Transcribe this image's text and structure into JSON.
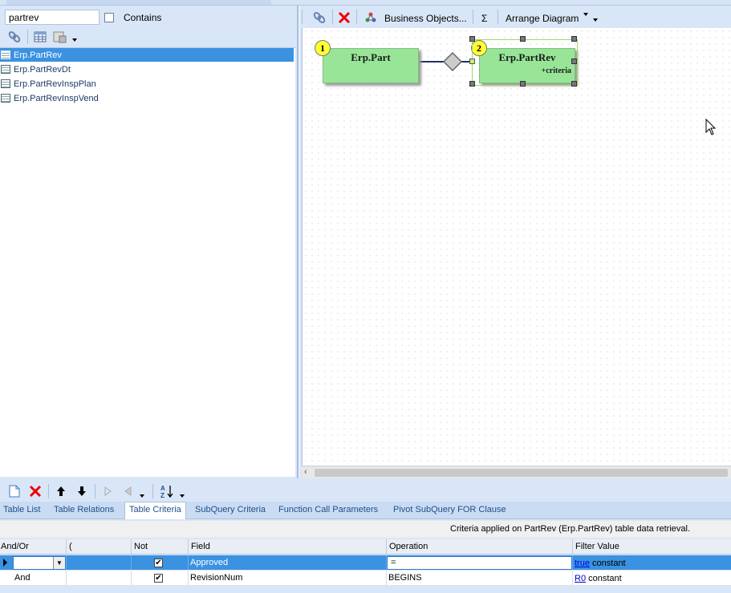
{
  "left": {
    "search_value": "partrev",
    "contains_label": "Contains",
    "tables": [
      "Erp.PartRev",
      "Erp.PartRevDt",
      "Erp.PartRevInspPlan",
      "Erp.PartRevInspVend"
    ],
    "selected_index": 0
  },
  "right_toolbar": {
    "business_objects_label": "Business Objects...",
    "sigma_label": "Σ",
    "arrange_label": "Arrange Diagram"
  },
  "diagram": {
    "entities": [
      {
        "badge": "1",
        "name": "Erp.Part",
        "subtitle": ""
      },
      {
        "badge": "2",
        "name": "Erp.PartRev",
        "subtitle": "+criteria"
      }
    ]
  },
  "tabs": [
    "Table List",
    "Table Relations",
    "Table Criteria",
    "SubQuery Criteria",
    "Function Call Parameters",
    "Pivot SubQuery FOR Clause"
  ],
  "active_tab": "Table Criteria",
  "info_text": "Criteria applied on PartRev (Erp.PartRev)  table data retrieval.",
  "grid": {
    "columns": [
      "And/Or",
      "(",
      "Not",
      "Field",
      "Operation",
      "Filter Value"
    ],
    "rows": [
      {
        "and_or": "",
        "paren": "",
        "not": true,
        "field": "Approved",
        "operation": "=",
        "value_link": "true",
        "value_type": "constant"
      },
      {
        "and_or": "And",
        "paren": "",
        "not": true,
        "field": "RevisionNum",
        "operation": "BEGINS",
        "value_link": "R0",
        "value_type": "constant"
      }
    ]
  },
  "colors": {
    "selection": "#3a92e0",
    "entity_fill": "#98e598",
    "badge": "#ffff33"
  }
}
